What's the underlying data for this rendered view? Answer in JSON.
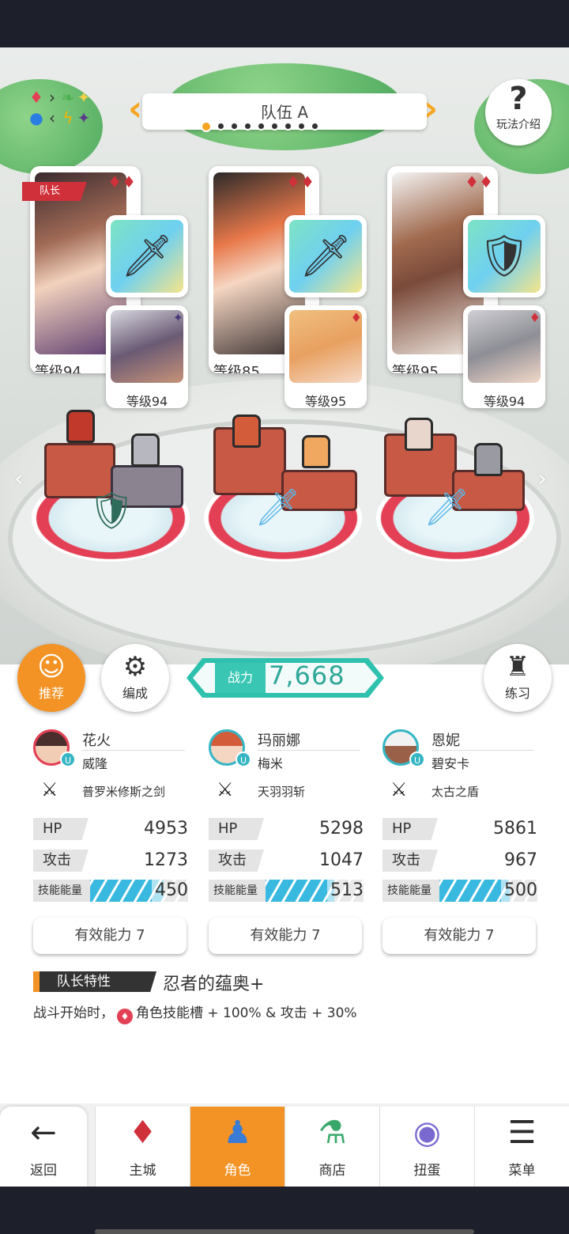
{
  "team": {
    "title": "队伍 A",
    "dots_total": 9,
    "dots_active": 1
  },
  "help": {
    "label": "玩法介绍"
  },
  "leader_tag": "队长",
  "characters": [
    {
      "main_level": "等级94",
      "sub_level": "等级94",
      "weapon_icon": "sword-icon"
    },
    {
      "main_level": "等级85",
      "sub_level": "等级95",
      "weapon_icon": "sword-icon"
    },
    {
      "main_level": "等级95",
      "sub_level": "等级94",
      "weapon_icon": "shield-icon"
    }
  ],
  "actions": {
    "recommend": "推荐",
    "formation": "编成",
    "practice": "练习"
  },
  "power": {
    "label": "战力",
    "value": "7,668"
  },
  "columns": [
    {
      "name": "花火",
      "sub": "威隆",
      "weapon": "普罗米修斯之剑",
      "hp_label": "HP",
      "hp": "4953",
      "atk_label": "攻击",
      "atk": "1273",
      "energy_label": "技能能量",
      "energy": "450",
      "energy_fill": 0.75,
      "eff": "有效能力 7"
    },
    {
      "name": "玛丽娜",
      "sub": "梅米",
      "weapon": "天羽羽斩",
      "hp_label": "HP",
      "hp": "5298",
      "atk_label": "攻击",
      "atk": "1047",
      "energy_label": "技能能量",
      "energy": "513",
      "energy_fill": 0.7,
      "eff": "有效能力 7"
    },
    {
      "name": "恩妮",
      "sub": "碧安卡",
      "weapon": "太古之盾",
      "hp_label": "HP",
      "hp": "5861",
      "atk_label": "攻击",
      "atk": "967",
      "energy_label": "技能能量",
      "energy": "500",
      "energy_fill": 0.72,
      "eff": "有效能力 7"
    }
  ],
  "leader_skill": {
    "tag": "队长特性",
    "title": "忍者的蕴奥+",
    "desc_before": "战斗开始时，",
    "desc_after": "角色技能槽 + 100% & 攻击 + 30%"
  },
  "nav": {
    "back": "返回",
    "city": "主城",
    "character": "角色",
    "shop": "商店",
    "gacha": "扭蛋",
    "menu": "菜单"
  },
  "colors": {
    "accent": "#f39325",
    "teal": "#2ec1ad",
    "red": "#e44055"
  }
}
